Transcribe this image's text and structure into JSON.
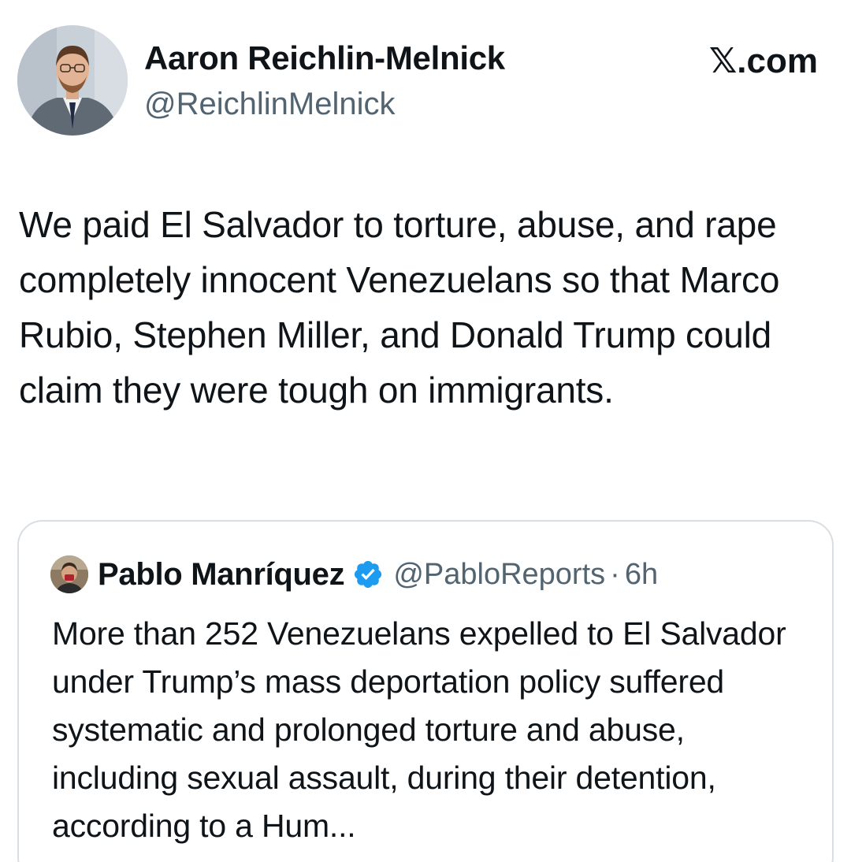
{
  "author": {
    "name": "Aaron Reichlin-Melnick",
    "handle": "@ReichlinMelnick",
    "avatar": "profile-photo"
  },
  "site_label": "𝕏.com",
  "tweet": {
    "text": "We paid El Salvador to torture, abuse, and rape completely innocent Venezuelans so that Marco Rubio, Stephen Miller, and Donald Trump could claim they were tough on immigrants."
  },
  "quoted_tweet": {
    "author_name": "Pablo Manríquez",
    "verified": true,
    "handle": "@PabloReports",
    "separator": "·",
    "time": "6h",
    "text": "More than 252 Venezuelans expelled to El Salvador under Trump’s mass deportation policy suffered systematic and prolonged torture and abuse, including sexual assault, during their detention, according to a Hum..."
  },
  "colors": {
    "text": "#0f1419",
    "secondary_text": "#536471",
    "verified_blue": "#1d9bf0",
    "card_border": "#d9dee2"
  }
}
